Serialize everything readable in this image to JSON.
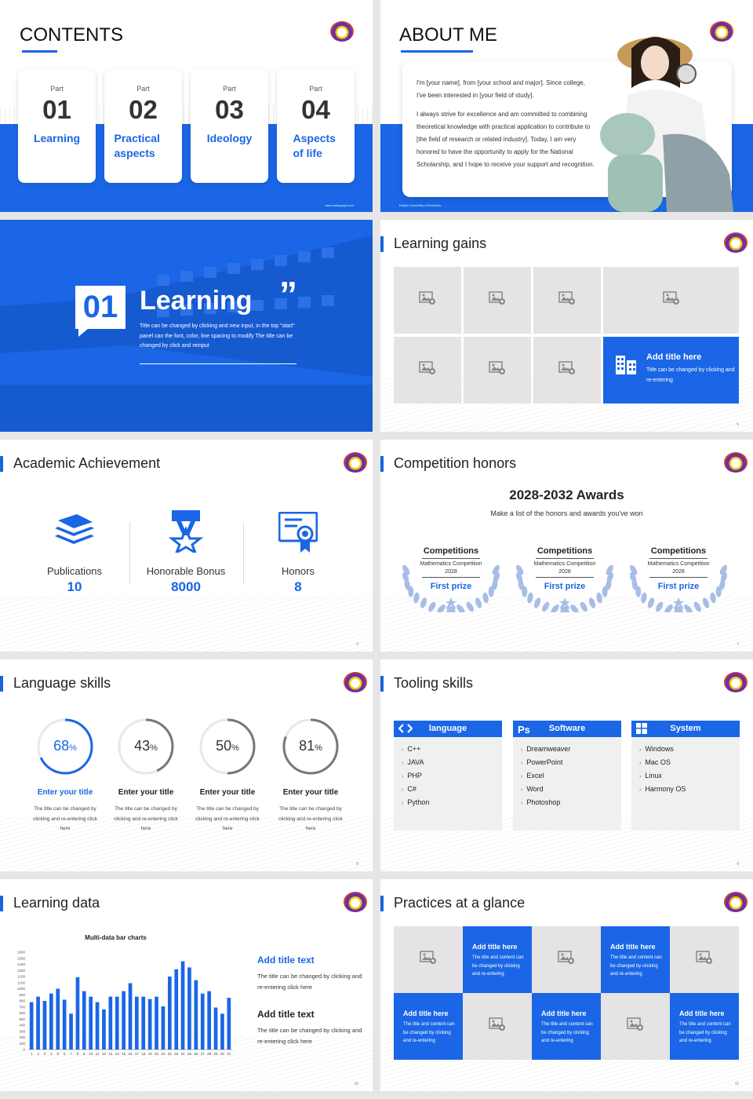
{
  "s1": {
    "title": "CONTENTS",
    "cards": [
      {
        "part": "Part",
        "num": "01",
        "label": "Learning"
      },
      {
        "part": "Part",
        "num": "02",
        "label": "Practical aspects"
      },
      {
        "part": "Part",
        "num": "03",
        "label": "Ideology"
      },
      {
        "part": "Part",
        "num": "04",
        "label": "Aspects of life"
      }
    ],
    "footer": "www.collegeppt.com"
  },
  "s2": {
    "title": "ABOUT ME",
    "paragraphs": [
      "I'm [your name], from [your school and major]. Since college, I've been interested in [your field of study].",
      "I always strive for excellence and am committed to combining theoretical knowledge with practical application to contribute to [the field of research or related industry]. Today, I am very honored to have the opportunity to apply for the National Scholarship, and I hope to receive your support and recognition."
    ],
    "footer": "Deakin University of Kentucky"
  },
  "s3": {
    "num": "01",
    "title": "Learning",
    "quote": "”",
    "desc": "Title can be changed by clicking and new input, in the top \"start\" panel can the font, color, line spacing to modify The title can be changed by click and reinput"
  },
  "s4": {
    "title": "Learning gains",
    "card_title": "Add title here",
    "card_text": "Title can be changed by clicking and re-entering",
    "page": "5"
  },
  "s5": {
    "title": "Academic Achievement",
    "items": [
      {
        "label": "Publications",
        "value": "10",
        "icon": "stack-icon"
      },
      {
        "label": "Honorable Bonus",
        "value": "8000",
        "icon": "medal-icon"
      },
      {
        "label": "Honors",
        "value": "8",
        "icon": "certificate-icon"
      }
    ],
    "page": "6"
  },
  "s6": {
    "title": "Competition honors",
    "heading": "2028-2032 Awards",
    "sub": "Make a list of the honors and awards you've won",
    "awards": [
      {
        "title": "Competitions",
        "line1": "Mathematics Competition",
        "year": "2028",
        "prize": "First prize"
      },
      {
        "title": "Competitions",
        "line1": "Mathematics Competition",
        "year": "2028",
        "prize": "First prize"
      },
      {
        "title": "Competitions",
        "line1": "Mathematics Competition",
        "year": "2028",
        "prize": "First prize"
      }
    ],
    "page": "7"
  },
  "s7": {
    "title": "Language skills",
    "items": [
      {
        "pct": "68",
        "sign": "%",
        "value": 0.68,
        "title": "Enter your title",
        "text": "The title can be changed by clicking and re-entering click here",
        "active": true
      },
      {
        "pct": "43",
        "sign": "%",
        "value": 0.43,
        "title": "Enter your title",
        "text": "The title can be changed by clicking and re-entering click here",
        "active": false
      },
      {
        "pct": "50",
        "sign": "%",
        "value": 0.5,
        "title": "Enter your title",
        "text": "The title can be changed by clicking and re-entering click here",
        "active": false
      },
      {
        "pct": "81",
        "sign": "%",
        "value": 0.81,
        "title": "Enter your title",
        "text": "The title can be changed by clicking and re-entering click here",
        "active": false
      }
    ],
    "page": "8"
  },
  "s8": {
    "title": "Tooling skills",
    "cols": [
      {
        "icon": "code-icon",
        "head": "language",
        "items": [
          "C++",
          "JAVA",
          "PHP",
          "C#",
          "Python"
        ]
      },
      {
        "icon": "photoshop-icon",
        "head": "Software",
        "items": [
          "Dreamweaver",
          "PowerPoint",
          "Excel",
          "Word",
          "Photoshop"
        ]
      },
      {
        "icon": "windows-icon",
        "head": "System",
        "items": [
          "Windows",
          "Mac OS",
          "Linux",
          "Harmony OS"
        ]
      }
    ],
    "page": "9"
  },
  "s9": {
    "title": "Learning data",
    "blocks": [
      {
        "title": "Add title text",
        "text": "The title can be changed by clicking and re-entering click here"
      },
      {
        "title": "Add title text",
        "text": "The title can be changed by clicking and re-entering click here"
      }
    ],
    "page": "10"
  },
  "s10": {
    "title": "Practices at a glance",
    "card_title": "Add title here",
    "card_text": "The title and content can be changed by clicking and re-entering",
    "page": "11"
  },
  "chart_data": {
    "type": "bar",
    "title": "Multi-data bar charts",
    "categories": [
      "1",
      "2",
      "3",
      "4",
      "5",
      "6",
      "7",
      "8",
      "9",
      "10",
      "11",
      "12",
      "13",
      "14",
      "15",
      "16",
      "17",
      "18",
      "19",
      "20",
      "21",
      "22",
      "23",
      "24",
      "25",
      "26",
      "27",
      "28",
      "29",
      "30",
      "31"
    ],
    "values": [
      780,
      870,
      800,
      920,
      1000,
      820,
      590,
      1190,
      960,
      870,
      780,
      660,
      870,
      870,
      960,
      1090,
      870,
      870,
      830,
      870,
      710,
      1200,
      1320,
      1450,
      1350,
      1140,
      920,
      960,
      690,
      590,
      850
    ],
    "ylim": [
      0,
      1600
    ],
    "yticks": [
      "0",
      "100",
      "200",
      "300",
      "400",
      "500",
      "600",
      "700",
      "800",
      "900",
      "1000",
      "1100",
      "1200",
      "1300",
      "1400",
      "1500",
      "1600"
    ],
    "color": "#1a66e6"
  },
  "colors": {
    "accent": "#1a66e6",
    "dark_blue": "#1565e0",
    "grey_tile": "#e5e3e3"
  }
}
